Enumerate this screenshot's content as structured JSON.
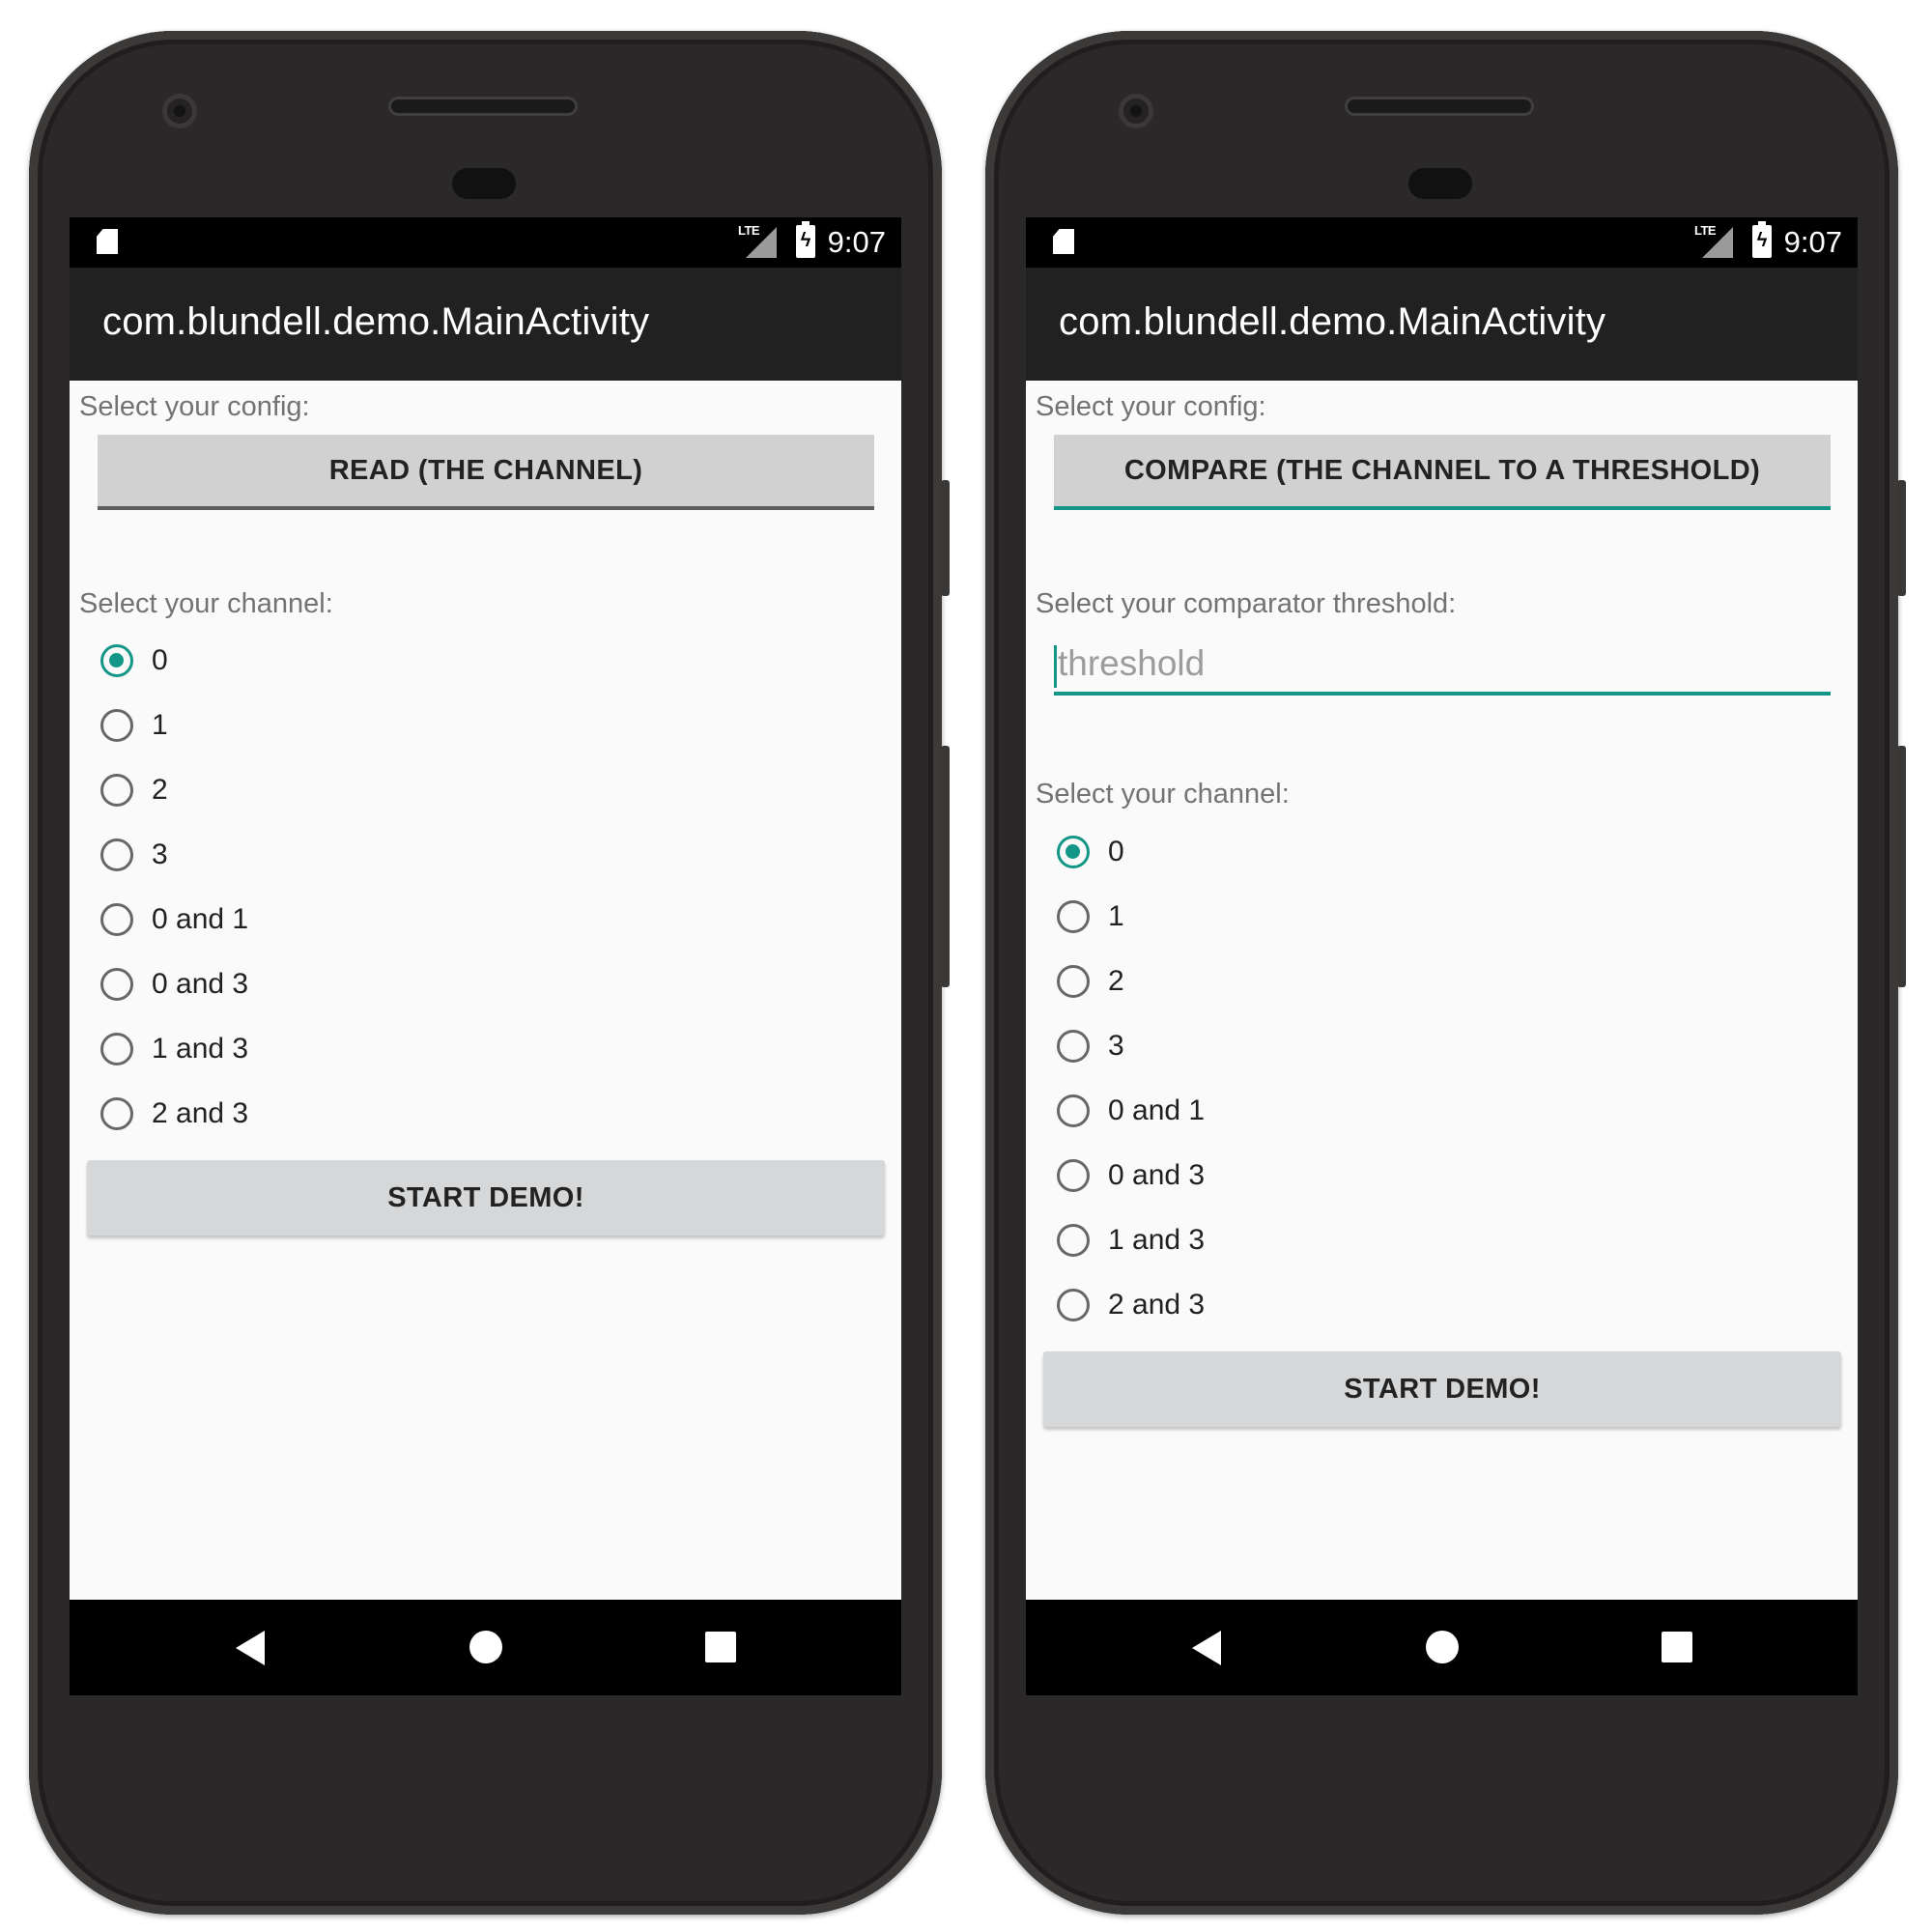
{
  "colors": {
    "accent": "#139688",
    "app_bar": "#212121",
    "screen_bg": "#fafafa",
    "button_bg": "#d6d7d8"
  },
  "left_phone": {
    "status_bar": {
      "network": "LTE",
      "time": "9:07",
      "icons": [
        "sd-card-icon",
        "signal-icon",
        "battery-charging-icon"
      ]
    },
    "app_title": "com.blundell.demo.MainActivity",
    "config_label": "Select your config:",
    "config_selected": "READ (THE CHANNEL)",
    "channel_label": "Select your channel:",
    "channels": [
      {
        "label": "0",
        "checked": true
      },
      {
        "label": "1",
        "checked": false
      },
      {
        "label": "2",
        "checked": false
      },
      {
        "label": "3",
        "checked": false
      },
      {
        "label": "0 and 1",
        "checked": false
      },
      {
        "label": "0 and 3",
        "checked": false
      },
      {
        "label": "1 and 3",
        "checked": false
      },
      {
        "label": "2 and 3",
        "checked": false
      }
    ],
    "start_button": "START DEMO!",
    "nav": [
      "back-icon",
      "home-icon",
      "recents-icon"
    ]
  },
  "right_phone": {
    "status_bar": {
      "network": "LTE",
      "time": "9:07",
      "icons": [
        "sd-card-icon",
        "signal-icon",
        "battery-charging-icon"
      ]
    },
    "app_title": "com.blundell.demo.MainActivity",
    "config_label": "Select your config:",
    "config_selected": "COMPARE (THE CHANNEL TO A THRESHOLD)",
    "threshold_label": "Select your comparator threshold:",
    "threshold_value": "",
    "threshold_placeholder": "threshold",
    "channel_label": "Select your channel:",
    "channels": [
      {
        "label": "0",
        "checked": true
      },
      {
        "label": "1",
        "checked": false
      },
      {
        "label": "2",
        "checked": false
      },
      {
        "label": "3",
        "checked": false
      },
      {
        "label": "0 and 1",
        "checked": false
      },
      {
        "label": "0 and 3",
        "checked": false
      },
      {
        "label": "1 and 3",
        "checked": false
      },
      {
        "label": "2 and 3",
        "checked": false
      }
    ],
    "start_button": "START DEMO!",
    "nav": [
      "back-icon",
      "home-icon",
      "recents-icon"
    ]
  }
}
